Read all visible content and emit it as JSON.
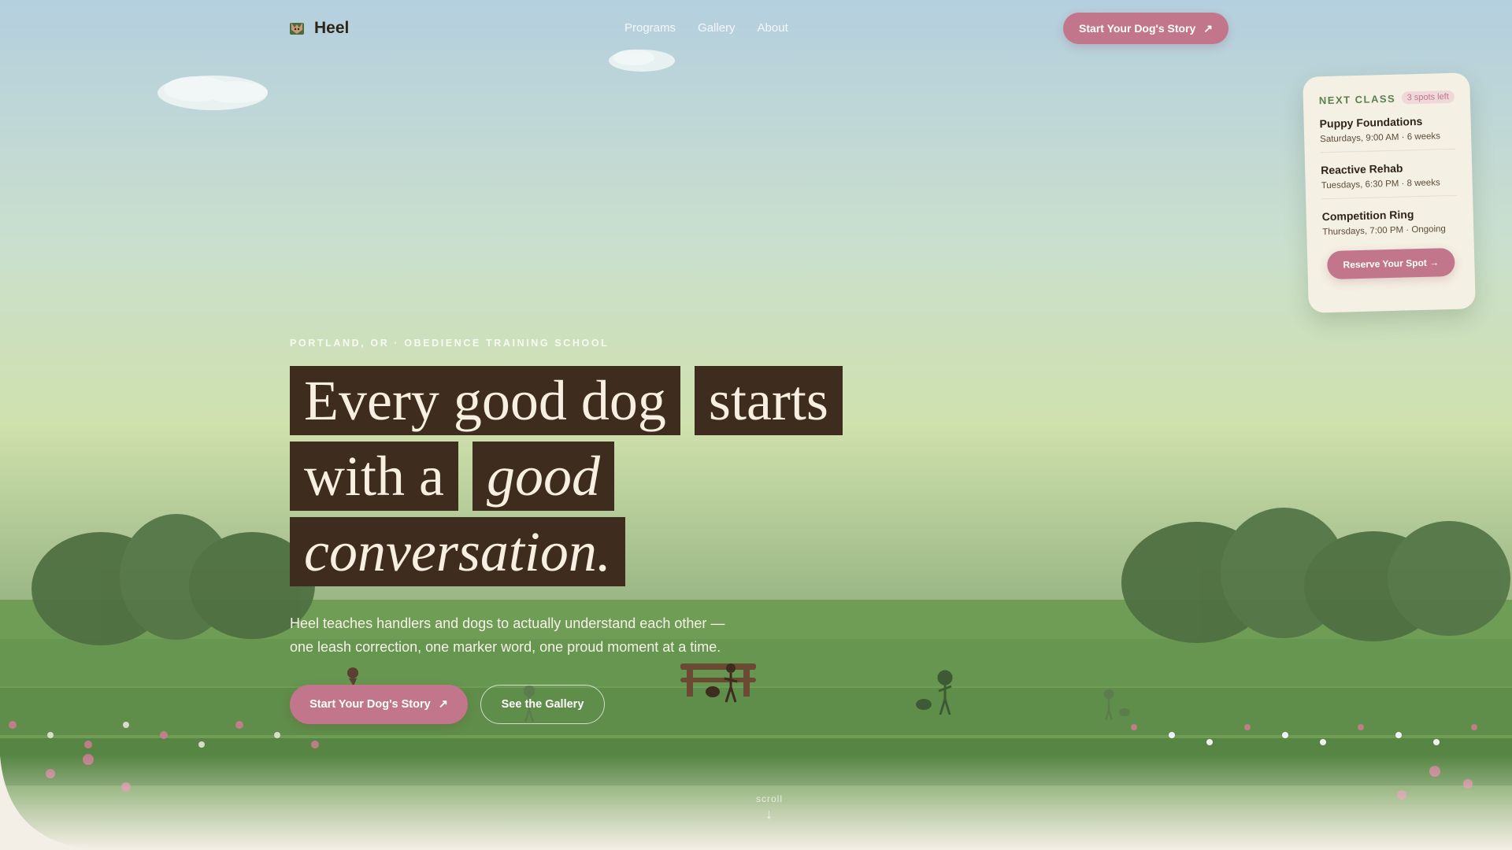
{
  "brand": {
    "name": "Heel",
    "logo_icon": "dog-logo-icon"
  },
  "nav": {
    "links": [
      "Programs",
      "Gallery",
      "About"
    ],
    "cta": "Start Your Dog's Story",
    "cta_icon": "arrow-up-right-icon"
  },
  "next_class": {
    "title": "NEXT CLASS",
    "badge": "3 spots left",
    "classes": [
      {
        "name": "Puppy Foundations",
        "meta": "Saturdays, 9:00 AM · 6 weeks"
      },
      {
        "name": "Reactive Rehab",
        "meta": "Tuesdays, 6:30 PM · 8 weeks"
      },
      {
        "name": "Competition Ring",
        "meta": "Thursdays, 7:00 PM · Ongoing"
      }
    ],
    "cta": "Reserve Your Spot →"
  },
  "hero": {
    "eyebrow": "PORTLAND, OR · OBEDIENCE TRAINING SCHOOL",
    "headline": {
      "line1_a": "Every good dog",
      "line1_b": "starts",
      "line2_a": "with a",
      "line2_b": "good",
      "line3": "conversation."
    },
    "lede_1": "Heel teaches handlers and dogs to actually understand each other —",
    "lede_2": "one leash correction, one marker word, one proud moment at a time.",
    "primary_cta": "Start Your Dog's Story",
    "secondary_cta": "See the Gallery",
    "scroll_label": "scroll",
    "scroll_icon": "arrow-down-icon"
  },
  "colors": {
    "accent": "#c2768b",
    "headline_bg": "#3e2c1e",
    "card_bg": "#f5f0e4",
    "grass": "#6f9d55",
    "tree": "#4f7041"
  }
}
